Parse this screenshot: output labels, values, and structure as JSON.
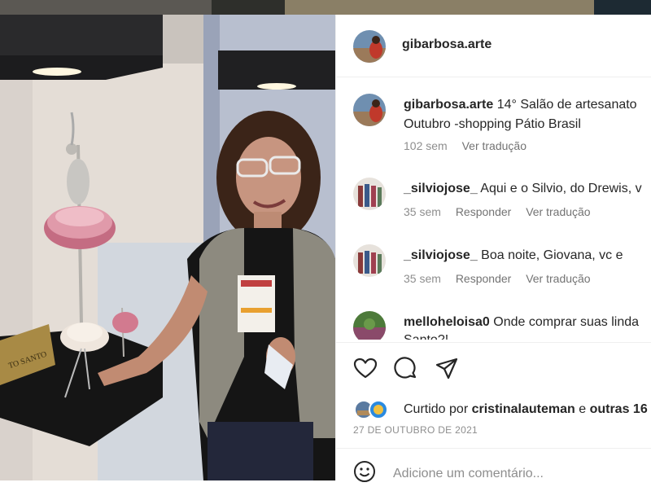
{
  "post": {
    "author": "gibarbosa.arte",
    "caption_author": "gibarbosa.arte",
    "caption_line1": "14° Salão de artesanato",
    "caption_line2": "Outubro -shopping Pátio Brasil",
    "caption_age": "102 sem",
    "translate_label": "Ver tradução"
  },
  "comments": [
    {
      "user": "_silviojose_",
      "text": "Aqui e o Silvio, do Drewis, v",
      "age": "35 sem",
      "reply": "Responder",
      "translate": "Ver tradução"
    },
    {
      "user": "_silviojose_",
      "text": "Boa noite, Giovana, vc e",
      "age": "35 sem",
      "reply": "Responder",
      "translate": "Ver tradução"
    },
    {
      "user": "melloheloisa0",
      "text": "Onde comprar suas linda",
      "text2": "Santo?!"
    }
  ],
  "likes": {
    "prefix": "Curtido por",
    "user": "cristinalauteman",
    "connector": "e",
    "others": "outras 16"
  },
  "date": "27 DE OUTUBRO DE 2021",
  "add_comment_placeholder": "Adicione um comentário...",
  "icons": [
    "heart-icon",
    "comment-icon",
    "share-icon",
    "emoji-icon"
  ]
}
